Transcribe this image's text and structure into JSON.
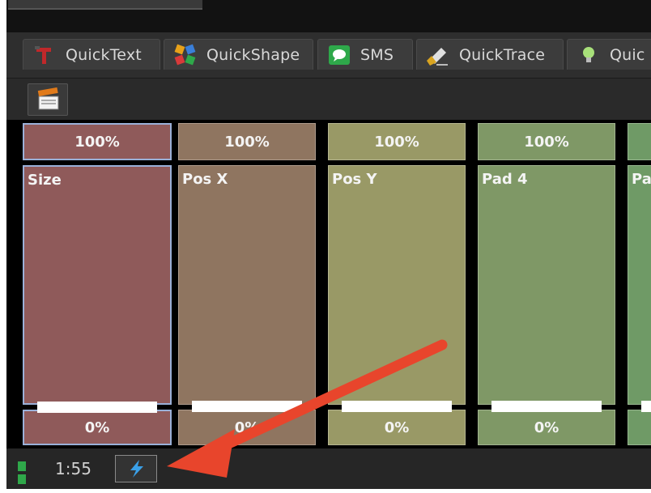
{
  "tabs": [
    {
      "label": "QuickText",
      "icon": "quicktext-icon"
    },
    {
      "label": "QuickShape",
      "icon": "quickshape-icon"
    },
    {
      "label": "SMS",
      "icon": "sms-icon"
    },
    {
      "label": "QuickTrace",
      "icon": "quicktrace-icon"
    },
    {
      "label": "Quic",
      "icon": "bulb-icon"
    }
  ],
  "toolbar": {
    "icon": "clapperboard-icon"
  },
  "pads": [
    {
      "label": "Size",
      "top": "100%",
      "bottom": "0%",
      "color": "#8f5a5a",
      "fader_level": 0.0,
      "selected": true
    },
    {
      "label": "Pos X",
      "top": "100%",
      "bottom": "0%",
      "color": "#8f7560",
      "fader_level": 0.0
    },
    {
      "label": "Pos Y",
      "top": "100%",
      "bottom": "0%",
      "color": "#999966",
      "fader_level": 0.0
    },
    {
      "label": "Pad 4",
      "top": "100%",
      "bottom": "0%",
      "color": "#7f9866",
      "fader_level": 0.0
    },
    {
      "label": "Pa",
      "top": "",
      "bottom": "",
      "color": "#6f9a66",
      "fader_level": 0.0
    }
  ],
  "status": {
    "time": "1:55",
    "button_icon": "lightning-icon"
  },
  "colors": {
    "annotation_arrow": "#e8452c",
    "status_led": "#2fa84a"
  }
}
